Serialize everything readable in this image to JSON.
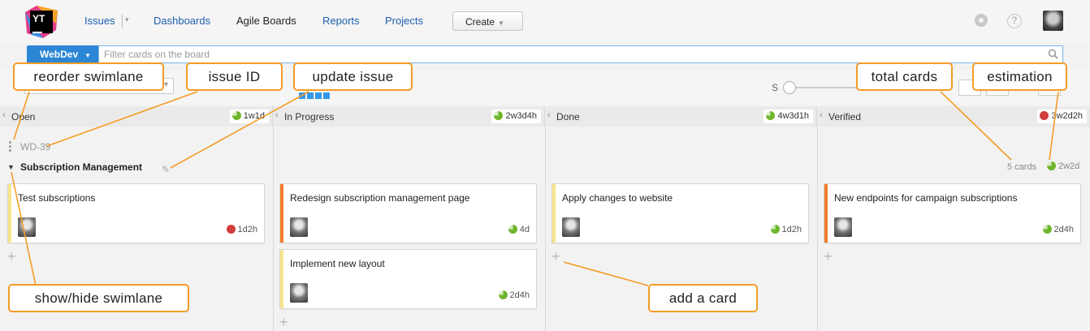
{
  "header": {
    "logo_text": "YT",
    "nav": [
      "Issues",
      "Dashboards",
      "Agile Boards",
      "Reports",
      "Projects"
    ],
    "create_label": "Create"
  },
  "search": {
    "board_label": "WebDev",
    "placeholder": "Filter cards on the board"
  },
  "toolbar": {
    "card_size_label": "S"
  },
  "columns": [
    {
      "name": "Open",
      "estimation": "1w1d"
    },
    {
      "name": "In Progress",
      "estimation": "2w3d4h"
    },
    {
      "name": "Done",
      "estimation": "4w3d1h"
    },
    {
      "name": "Verified",
      "estimation": "3w2d2h"
    }
  ],
  "swimlane": {
    "id": "WD-39",
    "title": "Subscription Management",
    "count": "5 cards",
    "estimation": "2w2d"
  },
  "cards": [
    {
      "title": "Test subscriptions",
      "estimation": "1d2h",
      "color": "#f7e58a"
    },
    {
      "title": "Redesign subscription management page",
      "estimation": "4d",
      "color": "#f07c2a"
    },
    {
      "title": "Implement new layout",
      "estimation": "2d4h",
      "color": "#f7e58a"
    },
    {
      "title": "Apply changes to website",
      "estimation": "1d2h",
      "color": "#f7e58a"
    },
    {
      "title": "New endpoints for campaign subscriptions",
      "estimation": "2d4h",
      "color": "#f07c2a"
    }
  ],
  "callouts": {
    "reorder": "reorder swimlane",
    "issue_id": "issue ID",
    "update": "update issue",
    "total": "total cards",
    "estimation": "estimation",
    "toggle": "show/hide swimlane",
    "add": "add a card"
  },
  "colors": {
    "accent": "#2b86d6",
    "callout_border": "#f49c26",
    "priority_major": "#f07c2a",
    "priority_normal": "#f7e58a"
  }
}
